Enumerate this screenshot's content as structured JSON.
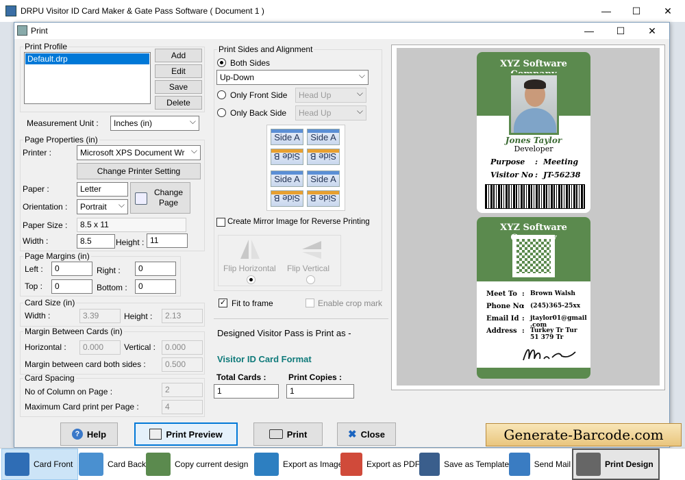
{
  "app": {
    "title": "DRPU Visitor ID Card Maker & Gate Pass Software ( Document 1 )"
  },
  "dialog": {
    "title": "Print"
  },
  "profile": {
    "legend": "Print Profile",
    "items": [
      "Default.drp"
    ],
    "add": "Add",
    "edit": "Edit",
    "save": "Save",
    "delete": "Delete"
  },
  "measurement": {
    "label": "Measurement Unit :",
    "value": "Inches (in)"
  },
  "page_props": {
    "legend": "Page Properties (in)",
    "printer_label": "Printer :",
    "printer_value": "Microsoft XPS Document Wr",
    "change_printer": "Change Printer Setting",
    "paper_label": "Paper :",
    "paper_value": "Letter",
    "change_page": "Change Page",
    "orientation_label": "Orientation :",
    "orientation_value": "Portrait",
    "paper_size_label": "Paper Size :",
    "paper_size_value": "8.5 x 11",
    "width_label": "Width :",
    "width_value": "8.5",
    "height_label": "Height :",
    "height_value": "11"
  },
  "margins": {
    "legend": "Page Margins (in)",
    "left_label": "Left :",
    "left": "0",
    "right_label": "Right :",
    "right": "0",
    "top_label": "Top :",
    "top": "0",
    "bottom_label": "Bottom :",
    "bottom": "0"
  },
  "card_size": {
    "legend": "Card Size (in)",
    "width_label": "Width :",
    "width": "3.39",
    "height_label": "Height :",
    "height": "2.13"
  },
  "margin_cards": {
    "legend": "Margin Between Cards (in)",
    "h_label": "Horizontal :",
    "h": "0.000",
    "v_label": "Vertical :",
    "v": "0.000",
    "both_label": "Margin between card both sides :",
    "both": "0.500"
  },
  "spacing": {
    "legend": "Card Spacing",
    "cols_label": "No of Column on Page :",
    "cols": "2",
    "max_label": "Maximum Card print per Page :",
    "max": "4"
  },
  "sides": {
    "legend": "Print Sides and Alignment",
    "both": "Both Sides",
    "both_mode": "Up-Down",
    "front": "Only Front Side",
    "front_mode": "Head Up",
    "back": "Only Back Side",
    "back_mode": "Head Up",
    "thumb_a": "Side A",
    "thumb_b": "Side B",
    "mirror": "Create Mirror Image for Reverse Printing",
    "flip_h": "Flip Horizontal",
    "flip_v": "Flip Vertical"
  },
  "fit": {
    "fit_label": "Fit to frame",
    "crop_label": "Enable crop mark"
  },
  "info": {
    "print_as": "Designed Visitor Pass is Print as -",
    "format": "Visitor ID Card Format",
    "total_label": "Total Cards :",
    "total": "1",
    "copies_label": "Print Copies :",
    "copies": "1"
  },
  "front_card": {
    "company": "XYZ Software Company",
    "name": "Jones Taylor",
    "role": "Developer",
    "purpose_label": "Purpose",
    "purpose": "Meeting",
    "visitor_label": "Visitor No",
    "visitor": "JT-56238",
    "sep": ":"
  },
  "back_card": {
    "company": "XYZ Software Company",
    "meet_label": "Meet To",
    "meet": "Brown Walsh",
    "phone_label": "Phone No",
    "phone": "(245)365-25xx",
    "email_label": "Email Id",
    "email": "jtaylor01@gmail .com",
    "address_label": "Address",
    "address": "Turkey Tr Tur 51 379 Tr",
    "sep": ":"
  },
  "buttons": {
    "help": "Help",
    "preview": "Print Preview",
    "print": "Print",
    "close": "Close"
  },
  "banner": "Generate-Barcode.com",
  "taskbar": {
    "card_front": "Card Front",
    "card_back": "Card Back",
    "copy": "Copy current design",
    "export_image": "Export as Image",
    "export_pdf": "Export as PDF",
    "save_template": "Save as Template",
    "send_mail": "Send Mail",
    "print_design": "Print Design"
  },
  "colors": {
    "card_green": "#5b8a4e",
    "format_teal": "#0f7a7a",
    "banner_bg": "#f2d9a0"
  }
}
